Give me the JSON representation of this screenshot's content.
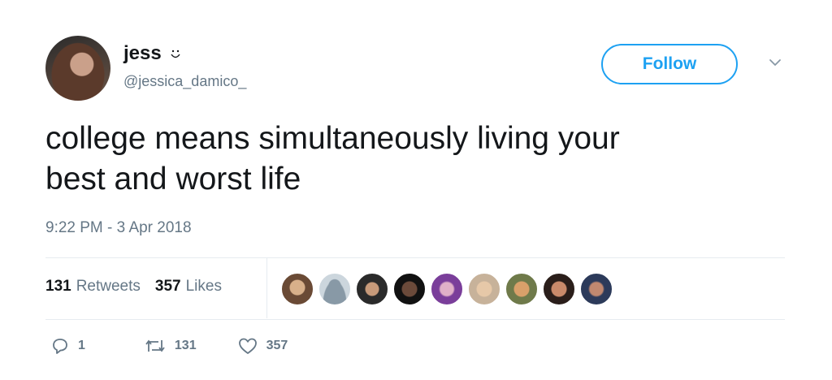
{
  "user": {
    "name": "jess",
    "handle": "@jessica_damico_"
  },
  "follow_button": {
    "label": "Follow"
  },
  "tweet": {
    "text_line1": "college means simultaneously living your",
    "text_line2": "best and worst life",
    "timestamp": "9:22 PM - 3 Apr 2018"
  },
  "stats": {
    "retweets_count": "131",
    "retweets_label": "Retweets",
    "likes_count": "357",
    "likes_label": "Likes"
  },
  "actions": {
    "reply_count": "1",
    "retweet_count": "131",
    "like_count": "357"
  },
  "colors": {
    "accent": "#1da1f2",
    "secondary_text": "#657786",
    "divider": "#e6ecf0"
  },
  "icons": [
    "smiley-icon",
    "chevron-down-icon",
    "reply-icon",
    "retweet-icon",
    "heart-icon"
  ]
}
